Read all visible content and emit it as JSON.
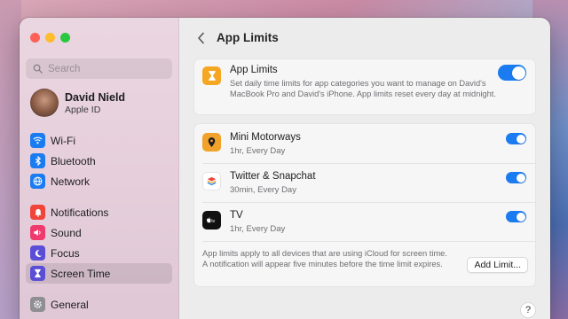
{
  "window": {
    "title": "App Limits"
  },
  "sidebar": {
    "search_placeholder": "Search",
    "profile": {
      "name": "David Nield",
      "subtitle": "Apple ID"
    },
    "groups": [
      [
        {
          "label": "Wi-Fi",
          "icon": "wifi-icon",
          "color": "#1a7cf0"
        },
        {
          "label": "Bluetooth",
          "icon": "bluetooth-icon",
          "color": "#1a7cf0"
        },
        {
          "label": "Network",
          "icon": "globe-icon",
          "color": "#1a7cf0"
        }
      ],
      [
        {
          "label": "Notifications",
          "icon": "bell-icon",
          "color": "#f0433a"
        },
        {
          "label": "Sound",
          "icon": "speaker-icon",
          "color": "#f03a6e"
        },
        {
          "label": "Focus",
          "icon": "moon-icon",
          "color": "#5b4ed6"
        },
        {
          "label": "Screen Time",
          "icon": "hourglass-icon",
          "color": "#5b4ed6",
          "selected": true
        }
      ],
      [
        {
          "label": "General",
          "icon": "gear-icon",
          "color": "#8e8e93"
        }
      ]
    ]
  },
  "main": {
    "header_title": "App Limits",
    "master": {
      "title": "App Limits",
      "description": "Set daily time limits for app categories you want to manage on David's MacBook Pro and David's iPhone. App limits reset every day at midnight.",
      "enabled": true
    },
    "apps": [
      {
        "name": "Mini Motorways",
        "limit": "1hr, Every Day",
        "enabled": true,
        "icon": "mini-motorways-icon"
      },
      {
        "name": "Twitter & Snapchat",
        "limit": "30min, Every Day",
        "enabled": true,
        "icon": "stack-icon"
      },
      {
        "name": "TV",
        "limit": "1hr, Every Day",
        "enabled": true,
        "icon": "apple-tv-icon"
      }
    ],
    "footer_note": "App limits apply to all devices that are using iCloud for screen time. A notification will appear five minutes before the time limit expires.",
    "add_button": "Add Limit...",
    "help_label": "?"
  },
  "colors": {
    "accent": "#1a7cf0",
    "screen_time": "#f5a623"
  }
}
